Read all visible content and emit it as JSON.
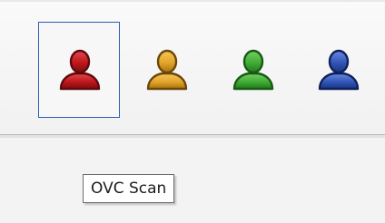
{
  "toolbar": {
    "buttons": [
      {
        "icon": "user-red-icon",
        "color": "#c0171b",
        "dark": "#5e0a0d",
        "selected": true
      },
      {
        "icon": "user-orange-icon",
        "color": "#e2a52a",
        "dark": "#6a4708",
        "selected": false
      },
      {
        "icon": "user-green-icon",
        "color": "#3fad35",
        "dark": "#175a13",
        "selected": false
      },
      {
        "icon": "user-blue-icon",
        "color": "#3156b8",
        "dark": "#0f215c",
        "selected": false
      }
    ],
    "selected_border": "#2c5db7"
  },
  "tooltip": {
    "text": "OVC Scan"
  }
}
